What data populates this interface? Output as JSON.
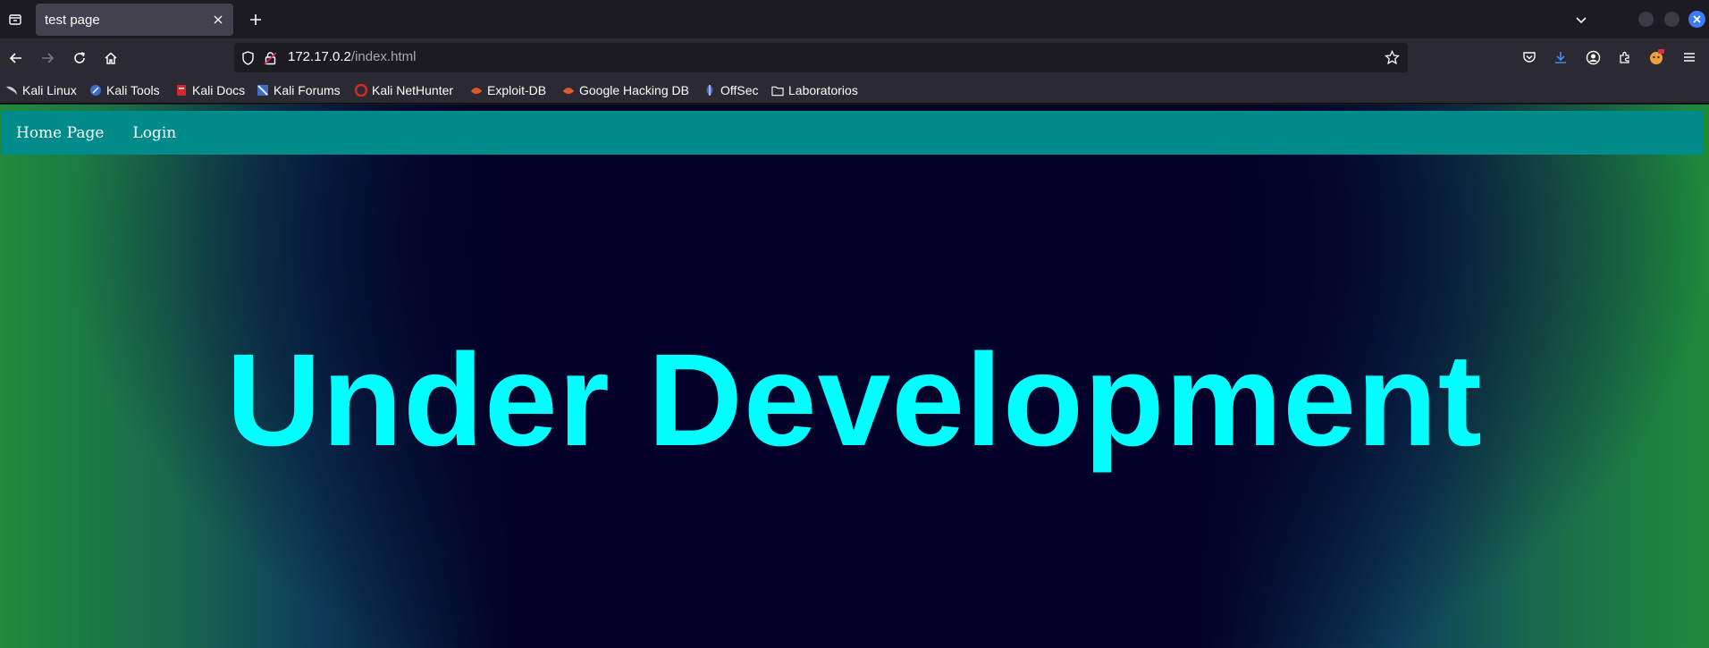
{
  "browser": {
    "tab": {
      "title": "test page"
    },
    "url": {
      "host": "172.17.0.2",
      "path": "/index.html"
    },
    "bookmarks": [
      {
        "label": "Kali Linux",
        "icon": "kali-dragon-icon"
      },
      {
        "label": "Kali Tools",
        "icon": "kali-tools-icon"
      },
      {
        "label": "Kali Docs",
        "icon": "kali-docs-icon"
      },
      {
        "label": "Kali Forums",
        "icon": "kali-forums-icon"
      },
      {
        "label": "Kali NetHunter",
        "icon": "nethunter-icon"
      },
      {
        "label": "Exploit-DB",
        "icon": "exploit-db-icon"
      },
      {
        "label": "Google Hacking DB",
        "icon": "ghdb-icon"
      },
      {
        "label": "OffSec",
        "icon": "offsec-icon"
      },
      {
        "label": "Laboratorios",
        "icon": "folder-icon"
      }
    ]
  },
  "page": {
    "nav": [
      {
        "label": "Home Page"
      },
      {
        "label": "Login"
      }
    ],
    "headline": "Under Development"
  },
  "colors": {
    "nav_bg": "#008b8b",
    "headline": "#00ffff",
    "page_center": "#020028",
    "page_edge": "#1e8a3a"
  }
}
